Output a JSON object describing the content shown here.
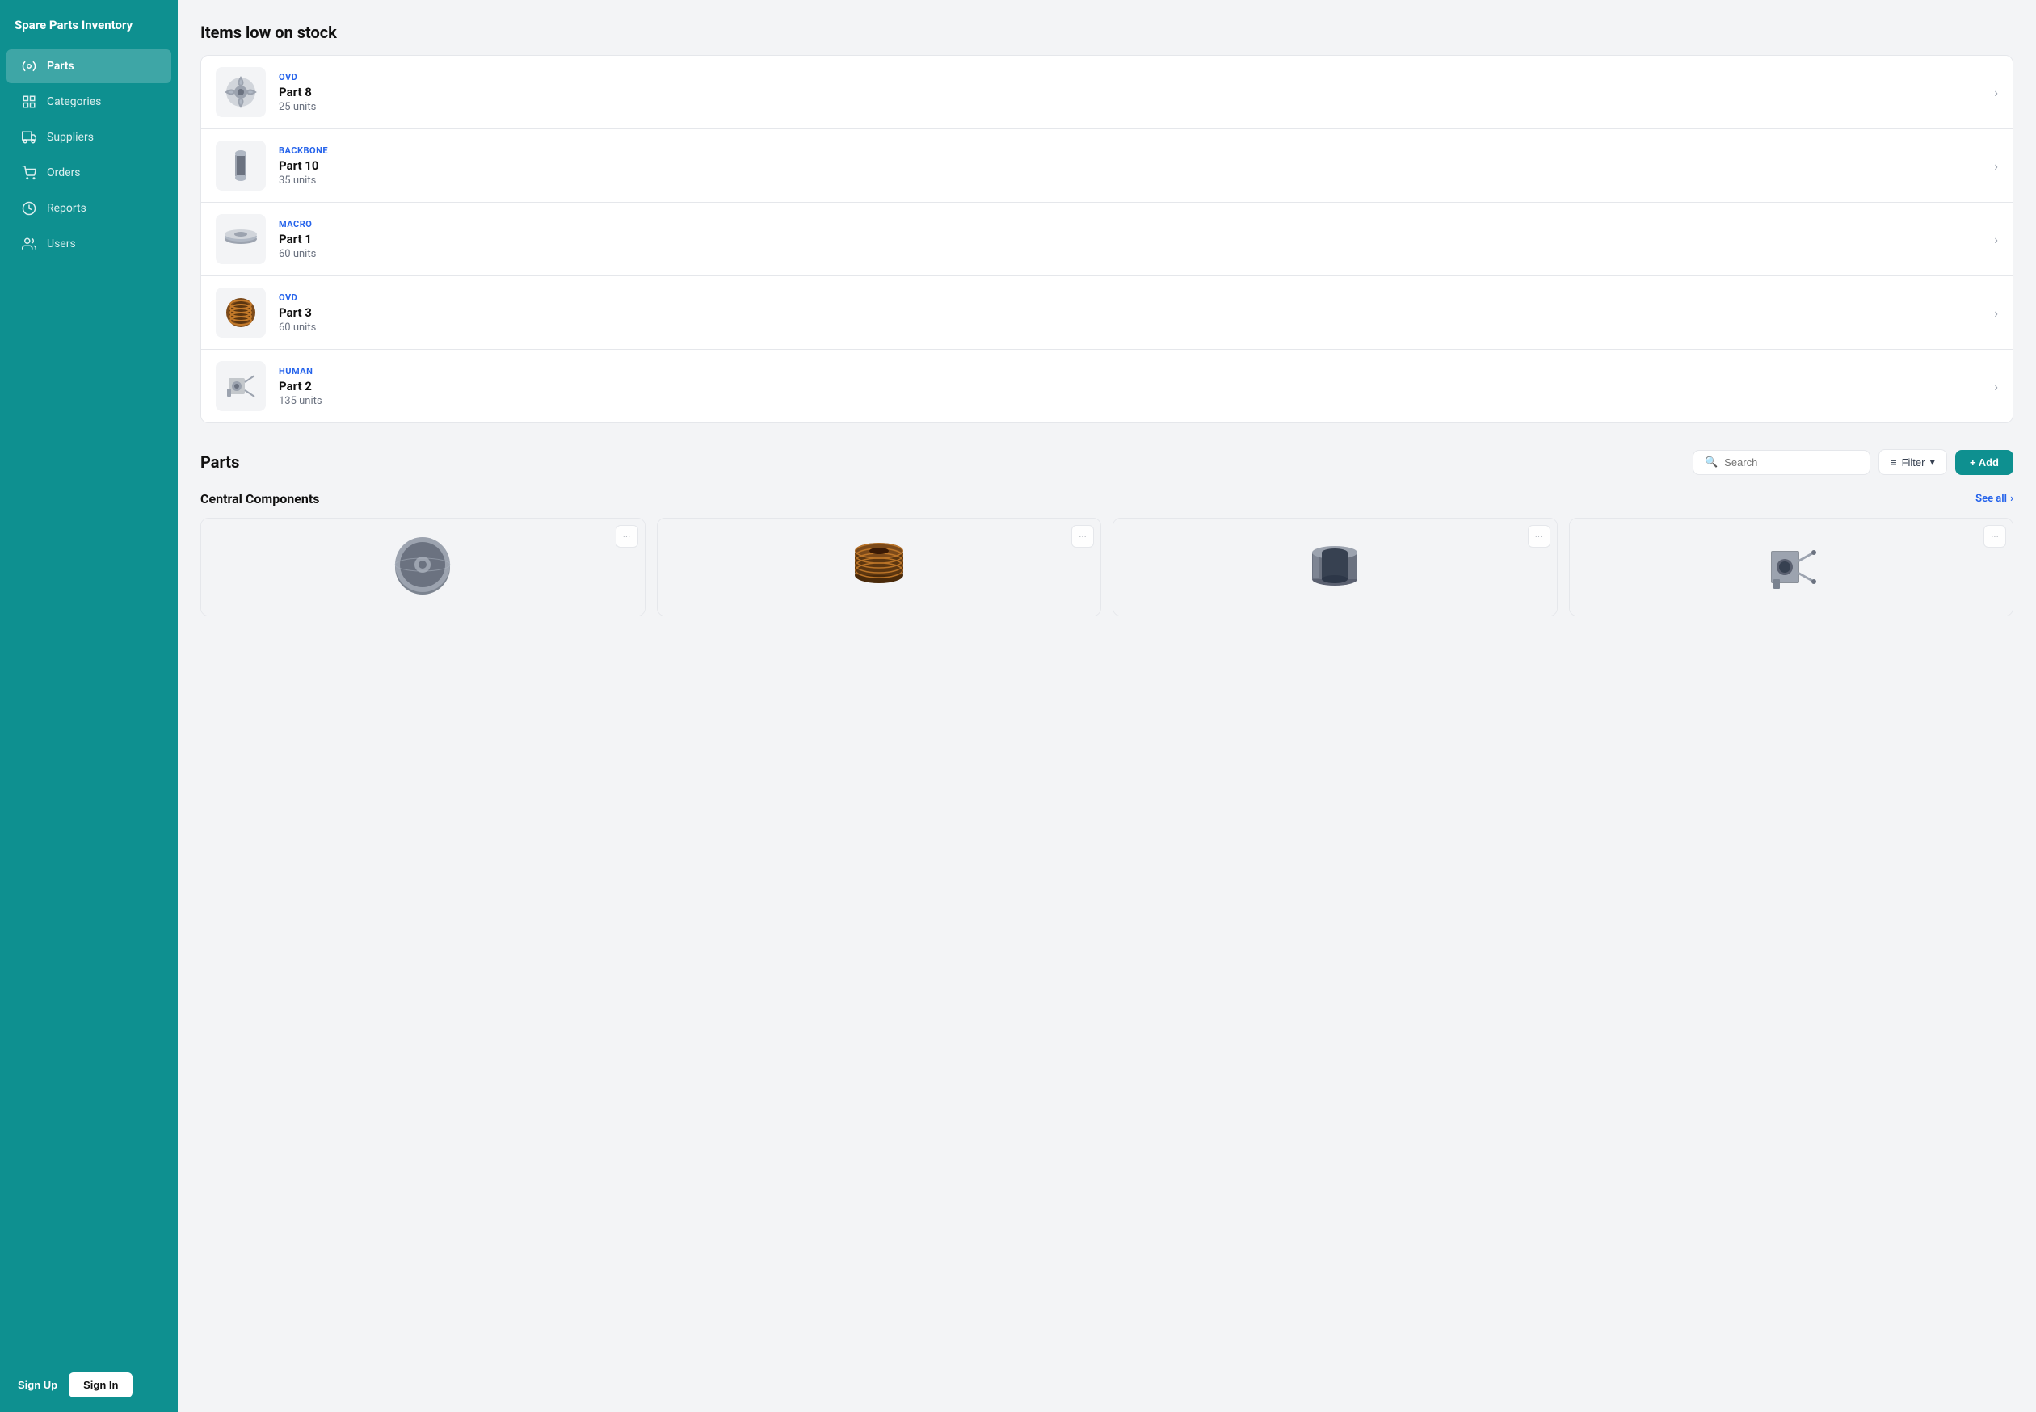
{
  "app": {
    "title": "Spare Parts Inventory"
  },
  "sidebar": {
    "nav_items": [
      {
        "id": "parts",
        "label": "Parts",
        "active": true
      },
      {
        "id": "categories",
        "label": "Categories",
        "active": false
      },
      {
        "id": "suppliers",
        "label": "Suppliers",
        "active": false
      },
      {
        "id": "orders",
        "label": "Orders",
        "active": false
      },
      {
        "id": "reports",
        "label": "Reports",
        "active": false
      },
      {
        "id": "users",
        "label": "Users",
        "active": false
      }
    ],
    "sign_up_label": "Sign Up",
    "sign_in_label": "Sign In"
  },
  "low_stock": {
    "section_title": "Items low on stock",
    "items": [
      {
        "vendor": "OVD",
        "name": "Part 8",
        "units": "25 units"
      },
      {
        "vendor": "BACKBONE",
        "name": "Part 10",
        "units": "35 units"
      },
      {
        "vendor": "MACRO",
        "name": "Part 1",
        "units": "60 units"
      },
      {
        "vendor": "OVD",
        "name": "Part 3",
        "units": "60 units"
      },
      {
        "vendor": "HUMAN",
        "name": "Part 2",
        "units": "135 units"
      }
    ]
  },
  "parts": {
    "section_title": "Parts",
    "search_placeholder": "Search",
    "filter_label": "Filter",
    "add_label": "+ Add",
    "subsection_title": "Central Components",
    "see_all_label": "See all",
    "cards": [
      {
        "id": 1,
        "shape": "disc"
      },
      {
        "id": 2,
        "shape": "coil"
      },
      {
        "id": 3,
        "shape": "ring"
      },
      {
        "id": 4,
        "shape": "bracket"
      }
    ]
  },
  "colors": {
    "teal": "#0e9090",
    "accent_blue": "#2563eb"
  }
}
